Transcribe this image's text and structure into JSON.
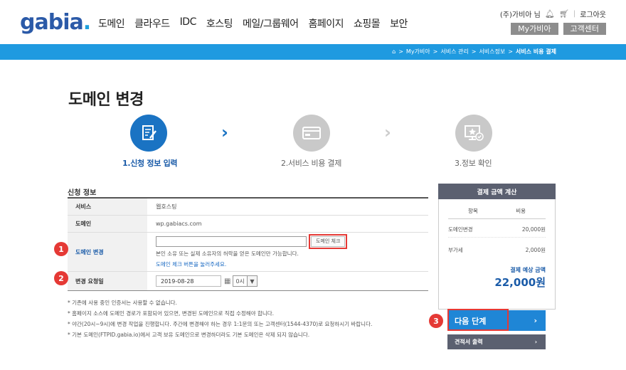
{
  "header": {
    "logo_text": "gabia",
    "logo_dot": ".",
    "nav": [
      "도메인",
      "클라우드",
      "IDC",
      "호스팅",
      "메일/그룹웨어",
      "홈페이지",
      "쇼핑몰",
      "보안"
    ],
    "user_name": "(주)가비아 님",
    "logout": "로그아웃",
    "my_gabia": "My가비아",
    "customer_center": "고객센터"
  },
  "breadcrumb": [
    "My가비아",
    "서비스 관리",
    "서비스정보",
    "서비스 비용 결제"
  ],
  "page_title": "도메인 변경",
  "steps": [
    {
      "label": "1.신청 정보 입력",
      "state": "active"
    },
    {
      "label": "2.서비스 비용 결제",
      "state": "inactive"
    },
    {
      "label": "3.정보 확인",
      "state": "inactive"
    }
  ],
  "form": {
    "section_title": "신청 정보",
    "service_label": "서비스",
    "service_value": "웹호스팅",
    "domain_label": "도메인",
    "domain_value": "wp.gabiacs.com",
    "change_label": "도메인 변경",
    "new_domain_value": "",
    "check_button": "도메인 체크",
    "hint": "본인 소유 또는 실제 소유자의 허락을 얻은 도메인만 가능합니다.",
    "hint_link": "도메인 체크 버튼을 눌러주세요.",
    "date_label": "변경 요청일",
    "date_value": "2019-08-28",
    "hour_value": "0시"
  },
  "notes": [
    "* 기존에 사용 중인 인증서는 사용할 수 없습니다.",
    "* 홈페이지 소스에 도메인 경로가 포함되어 있으면, 변경된 도메인으로 직접 수정해야 합니다.",
    "* 야간(20시~9시)에 변경 작업을 진행합니다. 주간에 변경해야 하는 경우 1:1문의 또는 고객센터(1544-4370)로 요청하시기 바랍니다.",
    "* 기본 도메인(FTPID.gabia.io)에서 고객 보유 도메인으로 변경하더라도 기본 도메인은 삭제 되지 않습니다."
  ],
  "side": {
    "title": "결제 금액 계산",
    "col_item": "항목",
    "col_cost": "비용",
    "rows": [
      {
        "item": "도메인변경",
        "cost": "20,000원"
      },
      {
        "item": "부가세",
        "cost": "2,000원"
      }
    ],
    "total_label": "결제 예상 금액",
    "total_value": "22,000원",
    "next_button": "다음 단계",
    "quote_button": "견적서 출력"
  },
  "badges": [
    "1",
    "2",
    "3"
  ],
  "colors": {
    "primary": "#1f9ae0",
    "active_step": "#1a73c3",
    "highlight": "#e53935"
  }
}
